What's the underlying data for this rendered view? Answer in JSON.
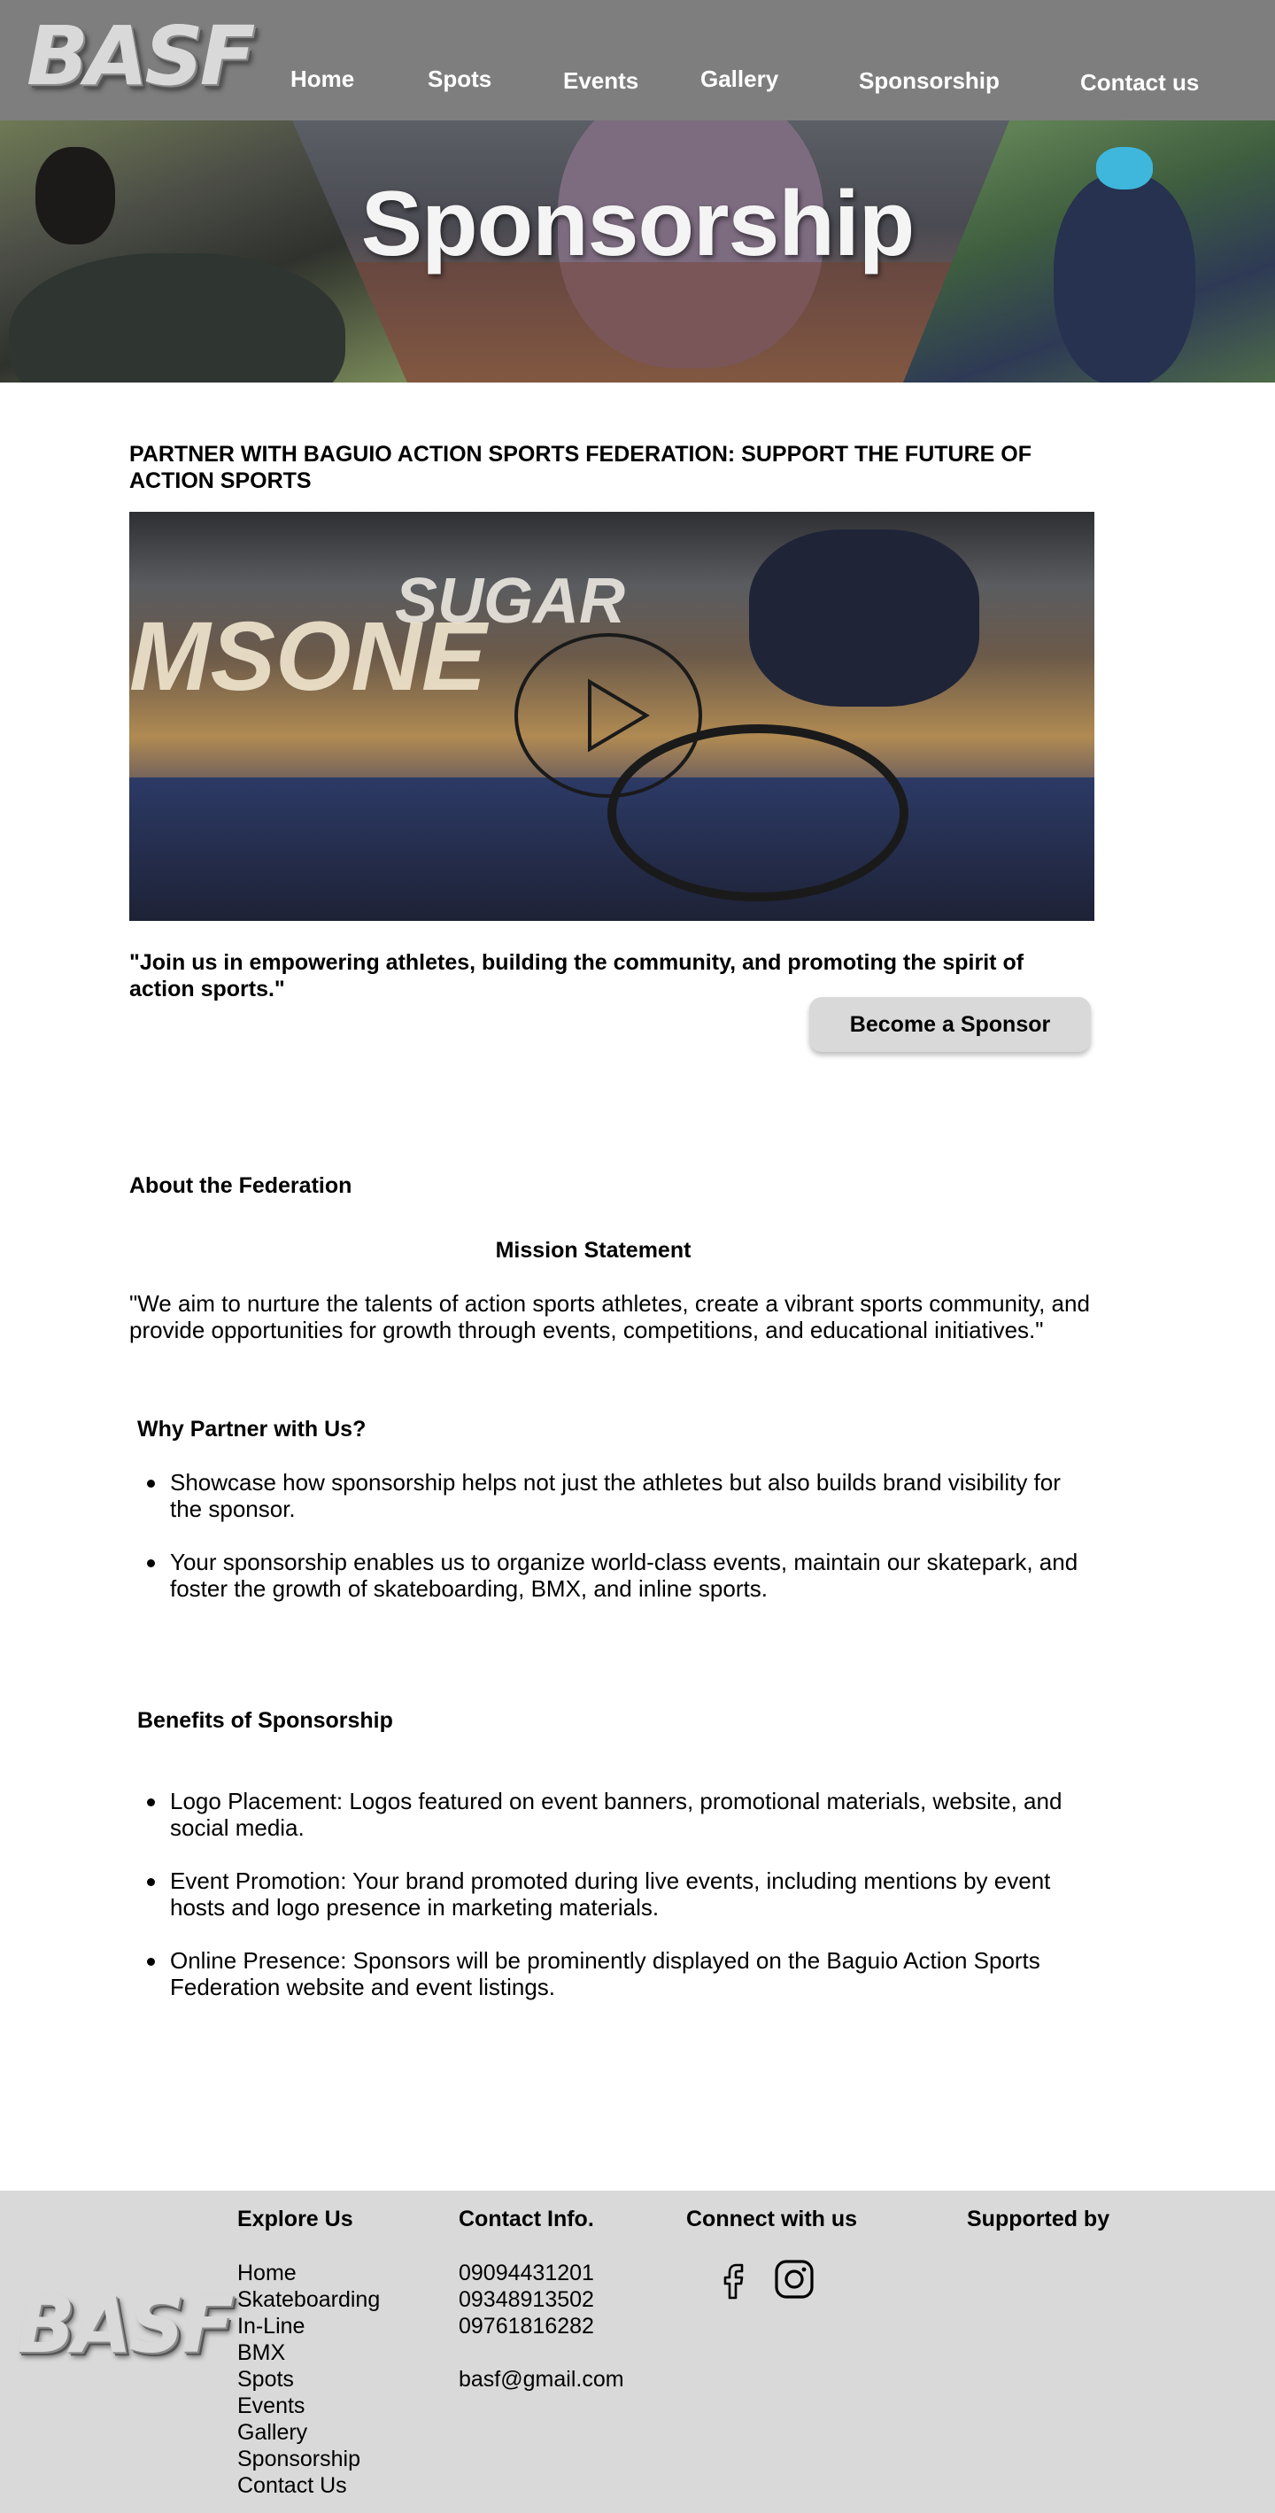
{
  "brand": {
    "logo_text": "BASF"
  },
  "nav": [
    {
      "label": "Home"
    },
    {
      "label": "Spots"
    },
    {
      "label": "Events"
    },
    {
      "label": "Gallery"
    },
    {
      "label": "Sponsorship"
    },
    {
      "label": "Contact us"
    }
  ],
  "hero": {
    "title": "Sponsorship"
  },
  "main": {
    "heading": "PARTNER WITH BAGUIO ACTION SPORTS FEDERATION: SUPPORT THE FUTURE OF ACTION SPORTS",
    "quote": "\"Join us in empowering athletes, building the community, and promoting the spirit of action sports.\"",
    "cta_label": "Become a Sponsor"
  },
  "about": {
    "title": "About the Federation",
    "mission_title": "Mission Statement",
    "mission_text": "\"We aim to nurture the talents of action sports athletes, create a vibrant sports community, and provide opportunities for growth through events, competitions, and educational initiatives.\"",
    "why_title": "Why Partner with Us?",
    "why_points": [
      "Showcase how sponsorship helps not just the athletes but also builds brand visibility for the sponsor.",
      "Your sponsorship enables us to organize world-class events, maintain our skatepark, and foster the growth of skateboarding, BMX, and inline sports."
    ],
    "benefits_title": "Benefits of Sponsorship",
    "benefits": [
      "Logo Placement: Logos featured on event banners, promotional materials, website, and social media.",
      "Event Promotion: Your brand promoted during live events, including mentions by event hosts and logo presence in marketing materials.",
      "Online Presence: Sponsors will be prominently displayed on the Baguio Action Sports Federation website and event listings."
    ]
  },
  "footer": {
    "explore_title": "Explore Us",
    "explore_links": [
      "Home",
      "Skateboarding",
      "In-Line",
      "BMX",
      "Spots",
      "Events",
      "Gallery",
      "Sponsorship",
      "Contact Us"
    ],
    "contact_title": "Contact Info.",
    "phones": [
      "09094431201",
      "09348913502",
      "09761816282"
    ],
    "email": "basf@gmail.com",
    "connect_title": "Connect with us",
    "social_icons": [
      "facebook-icon",
      "instagram-icon"
    ],
    "supported_title": "Supported by"
  }
}
